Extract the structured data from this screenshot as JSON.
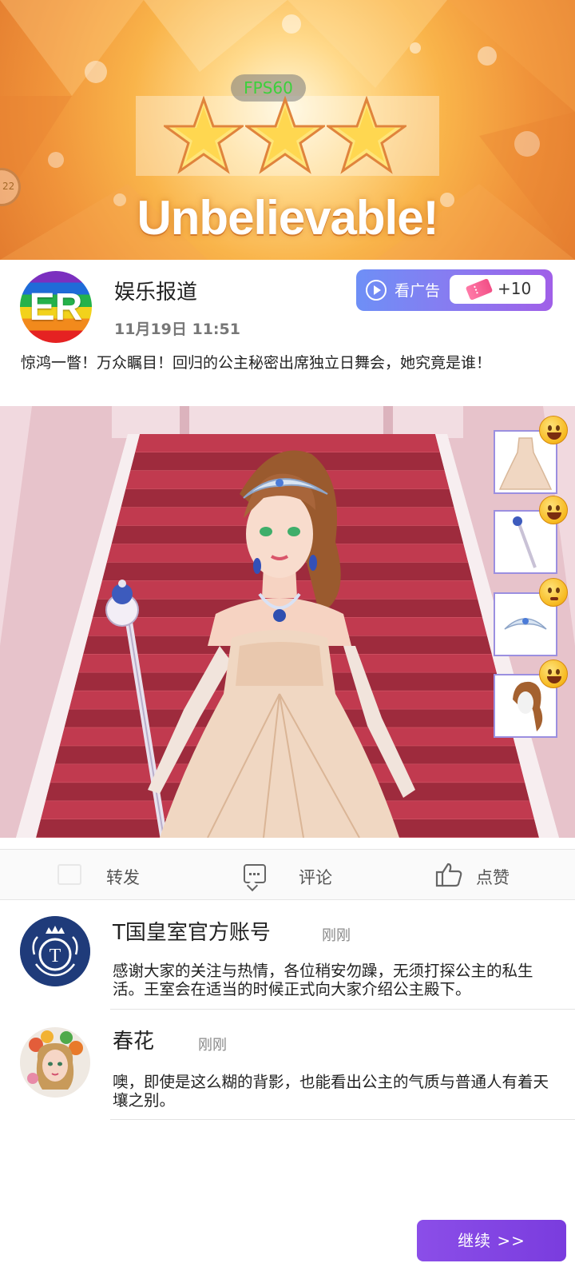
{
  "result": {
    "fps": "FPS60",
    "side_tab": "22",
    "stars_earned": 3,
    "stars_total": 3,
    "headline": "Unbelievable!"
  },
  "post": {
    "author": "娱乐报道",
    "avatar_text": "ER",
    "timestamp": "11月19日 11:51",
    "text": "惊鸿一瞥！万众瞩目！回归的公主秘密出席独立日舞会，她究竟是谁！",
    "ad_button": {
      "label": "看广告",
      "reward": "+10",
      "icon": "ticket-icon"
    }
  },
  "outfit_items": [
    {
      "name": "gown",
      "icon": "dress-icon",
      "reaction": "grinning"
    },
    {
      "name": "scepter",
      "icon": "scepter-icon",
      "reaction": "grinning"
    },
    {
      "name": "tiara",
      "icon": "tiara-icon",
      "reaction": "neutral"
    },
    {
      "name": "hairstyle",
      "icon": "hair-icon",
      "reaction": "grinning"
    }
  ],
  "actions": {
    "share": "转发",
    "comment": "评论",
    "like": "点赞"
  },
  "comments": [
    {
      "author": "T国皇室官方账号",
      "time": "刚刚",
      "text": "感谢大家的关注与热情，各位稍安勿躁，无须打探公主的私生活。王室会在适当的时候正式向大家介绍公主殿下。",
      "avatar_letter": "T"
    },
    {
      "author": "春花",
      "time": "刚刚",
      "text": "噢，即使是这么糊的背影，也能看出公主的气质与普通人有着天壤之别。"
    }
  ],
  "continue_label": "继续 >>",
  "colors": {
    "accent": "#7a3cde",
    "ad_gradient_start": "#6e8ff6",
    "ad_gradient_end": "#a05fe8",
    "carpet": "#c13a4f",
    "fps_text": "#3bd13b"
  }
}
